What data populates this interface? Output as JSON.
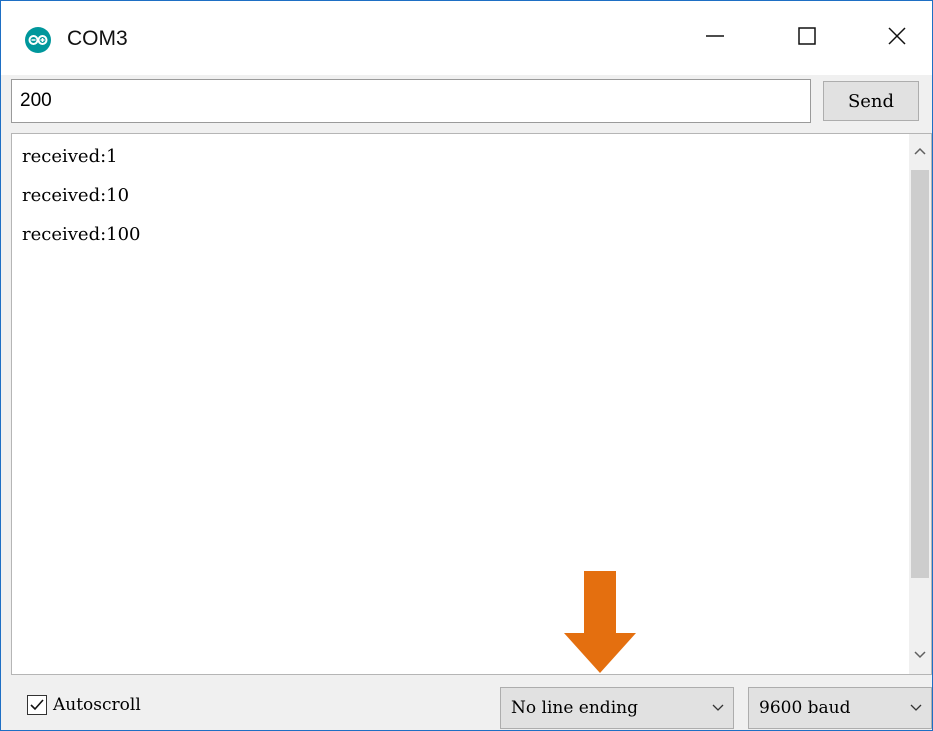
{
  "window": {
    "title": "COM3",
    "icon": "arduino-icon",
    "controls": [
      "minimize-icon",
      "maximize-icon",
      "close-icon"
    ]
  },
  "input": {
    "value": "200",
    "send_label": "Send"
  },
  "output": {
    "lines": [
      "received:1",
      "received:10",
      "received:100"
    ]
  },
  "bottom": {
    "autoscroll_label": "Autoscroll",
    "autoscroll_checked": true,
    "line_ending_selected": "No line ending",
    "baud_selected": "9600 baud"
  },
  "annotation": {
    "arrow_color": "#e46f0f",
    "arrow_direction": "down"
  },
  "colors": {
    "window_border": "#1e6fc4",
    "arduino_teal": "#00979c"
  }
}
